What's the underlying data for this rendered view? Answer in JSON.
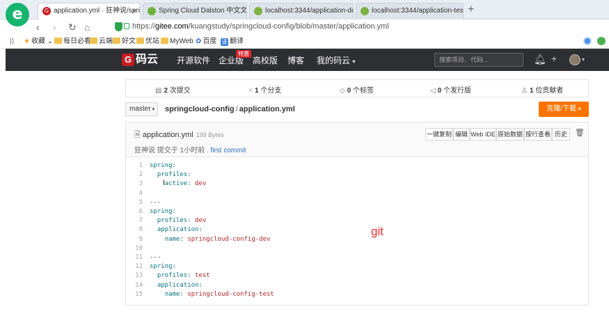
{
  "browser": {
    "tabs": [
      {
        "label": "application.yml · 狂神说/sprin",
        "active": true
      },
      {
        "label": "Spring Cloud Dalston 中文文档"
      },
      {
        "label": "localhost:3344/application-de"
      },
      {
        "label": "localhost:3344/application-tes"
      }
    ],
    "new_tab": "+",
    "url": {
      "scheme": "https://",
      "host": "gitee.com",
      "path": "/kuangstudy/springcloud-config/blob/master/application.yml"
    }
  },
  "bookmarks": [
    "收藏",
    "每日必看",
    "云端",
    "好文",
    "优站",
    "MyWeb",
    "百度",
    "翻译"
  ],
  "gitee": {
    "logo": "码云",
    "nav": [
      "开源软件",
      "企业版",
      "高校版",
      "博客",
      "我的码云"
    ],
    "hot_badge": "特惠",
    "search_placeholder": "搜索项目、代码..."
  },
  "stats": {
    "commits": {
      "count": "2",
      "label": "次提交"
    },
    "branches": {
      "count": "1",
      "label": "个分支"
    },
    "tags": {
      "count": "0",
      "label": "个标签"
    },
    "releases": {
      "count": "0",
      "label": "个发行版"
    },
    "contributors": {
      "count": "1",
      "label": "位贡献者"
    }
  },
  "branch": "master",
  "breadcrumb": {
    "repo": "springcloud-config",
    "file": "application.yml"
  },
  "clone_button": "克隆/下载",
  "file": {
    "name": "application.yml",
    "size": "199 Bytes",
    "commit_author": "狂神说",
    "commit_text": "提交于 1小时前 .",
    "commit_message": "first commit",
    "actions": [
      "一键复制",
      "编辑",
      "Web IDE",
      "原始数据",
      "按行查看",
      "历史"
    ]
  },
  "code_lines": [
    {
      "n": "1",
      "text": "spring:"
    },
    {
      "n": "2",
      "text": "  profiles:"
    },
    {
      "n": "3",
      "text": "    active: dev"
    },
    {
      "n": "4",
      "text": ""
    },
    {
      "n": "5",
      "text": "---"
    },
    {
      "n": "6",
      "text": "spring:"
    },
    {
      "n": "7",
      "text": "  profiles: dev"
    },
    {
      "n": "8",
      "text": "  application:"
    },
    {
      "n": "9",
      "text": "    name: springcloud-config-dev"
    },
    {
      "n": "10",
      "text": ""
    },
    {
      "n": "11",
      "text": "---"
    },
    {
      "n": "12",
      "text": "spring:"
    },
    {
      "n": "13",
      "text": "  profiles: test"
    },
    {
      "n": "14",
      "text": "  application:"
    },
    {
      "n": "15",
      "text": "    name: springcloud-config-test"
    }
  ],
  "overlay_label": "git"
}
